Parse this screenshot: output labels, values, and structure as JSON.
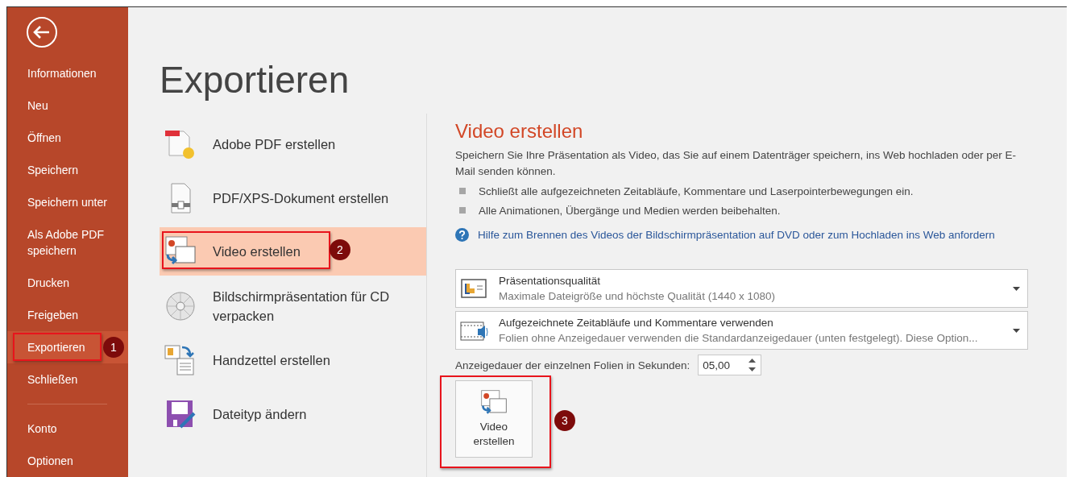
{
  "sidebar": {
    "items": [
      {
        "label": "Informationen",
        "selected": false
      },
      {
        "label": "Neu",
        "selected": false
      },
      {
        "label": "Öffnen",
        "selected": false
      },
      {
        "label": "Speichern",
        "selected": false
      },
      {
        "label": "Speichern unter",
        "selected": false
      },
      {
        "label": "Als Adobe PDF speichern",
        "selected": false
      },
      {
        "label": "Drucken",
        "selected": false
      },
      {
        "label": "Freigeben",
        "selected": false
      },
      {
        "label": "Exportieren",
        "selected": true,
        "callout": "1"
      },
      {
        "label": "Schließen",
        "selected": false
      }
    ],
    "footer_items": [
      {
        "label": "Konto",
        "selected": false
      },
      {
        "label": "Optionen",
        "selected": false
      }
    ]
  },
  "page_title": "Exportieren",
  "export_options": [
    {
      "kind": "adobe-pdf",
      "label": "Adobe PDF erstellen",
      "selected": false
    },
    {
      "kind": "pdf-xps",
      "label": "PDF/XPS-Dokument erstellen",
      "selected": false
    },
    {
      "kind": "video",
      "label": "Video erstellen",
      "selected": true,
      "callout": "2"
    },
    {
      "kind": "cd",
      "label": "Bildschirmpräsentation für CD verpacken",
      "selected": false
    },
    {
      "kind": "handout",
      "label": "Handzettel erstellen",
      "selected": false
    },
    {
      "kind": "filetype",
      "label": "Dateityp ändern",
      "selected": false
    }
  ],
  "detail": {
    "title": "Video erstellen",
    "description": "Speichern Sie Ihre Präsentation als Video, das Sie auf einem Datenträger speichern, ins Web hochladen oder per E-Mail senden können.",
    "bullets": [
      "Schließt alle aufgezeichneten Zeitabläufe, Kommentare und Laserpointerbewegungen ein.",
      "Alle Animationen, Übergänge und Medien werden beibehalten."
    ],
    "help_link": "Hilfe zum Brennen des Videos der Bildschirmpräsentation auf DVD oder zum Hochladen ins Web anfordern",
    "dropdowns": [
      {
        "kind": "quality",
        "title": "Präsentationsqualität",
        "subtitle": "Maximale Dateigröße und höchste Qualität (1440 x 1080)"
      },
      {
        "kind": "timings",
        "title": "Aufgezeichnete Zeitabläufe und Kommentare verwenden",
        "subtitle": "Folien ohne Anzeigedauer verwenden die Standardanzeigedauer (unten festgelegt). Diese Option..."
      }
    ],
    "duration": {
      "label": "Anzeigedauer der einzelnen Folien in Sekunden:",
      "value": "05,00"
    },
    "create_button": {
      "label": "Video erstellen",
      "callout": "3"
    }
  }
}
